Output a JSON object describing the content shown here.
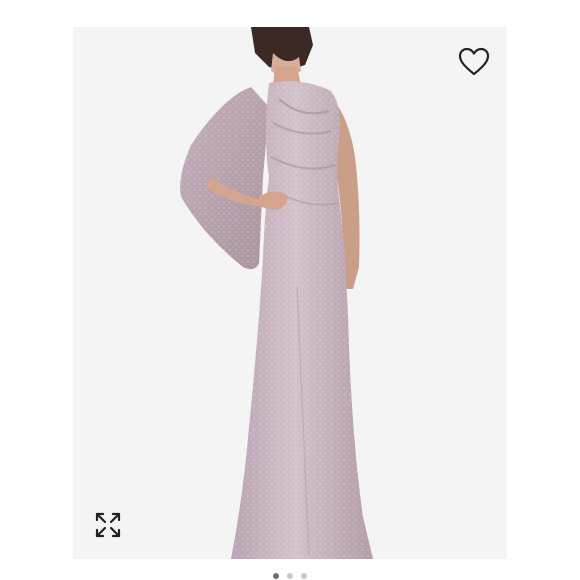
{
  "colors": {
    "page_background": "#ffffff",
    "photo_background": "#f4f4f4",
    "dress": "#c7b3bf",
    "icon_stroke": "#222222",
    "dot_active": "#6f6f6f",
    "dot_inactive": "#c8c8c8"
  },
  "product_image": {
    "subject": "long-sleeve-cape-gown"
  },
  "controls": {
    "favorite_icon": "heart-outline-icon",
    "expand_icon": "expand-arrows-icon"
  },
  "pager": {
    "count": 3,
    "active_index": 0
  }
}
